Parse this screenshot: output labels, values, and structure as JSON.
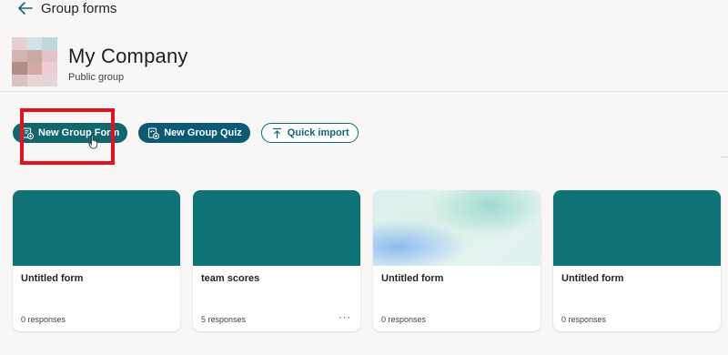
{
  "topbar": {
    "title": "Group forms"
  },
  "group": {
    "name": "My Company",
    "subtitle": "Public group",
    "avatar_tiles": [
      "#e8cfd2",
      "#cfe4e6",
      "#bcd9e0",
      "#d4b4b0",
      "#c9a9a2",
      "#e2c3c8",
      "#b18e8a",
      "#d7a9a5",
      "#f0cdd3",
      "#dcc2c0",
      "#e9d5d2",
      "#e6d3db"
    ]
  },
  "actions": {
    "new_form": "New Group Form",
    "new_quiz": "New Group Quiz",
    "quick_import": "Quick import"
  },
  "colors": {
    "accent": "#0f6870",
    "highlight": "#e8101a"
  },
  "cards": [
    {
      "title": "Untitled form",
      "responses": "0 responses",
      "banner": "teal",
      "more": ""
    },
    {
      "title": "team scores",
      "responses": "5 responses",
      "banner": "teal",
      "more": "···"
    },
    {
      "title": "Untitled form",
      "responses": "0 responses",
      "banner": "gradient",
      "more": ""
    },
    {
      "title": "Untitled form",
      "responses": "0 responses",
      "banner": "teal",
      "more": ""
    }
  ]
}
